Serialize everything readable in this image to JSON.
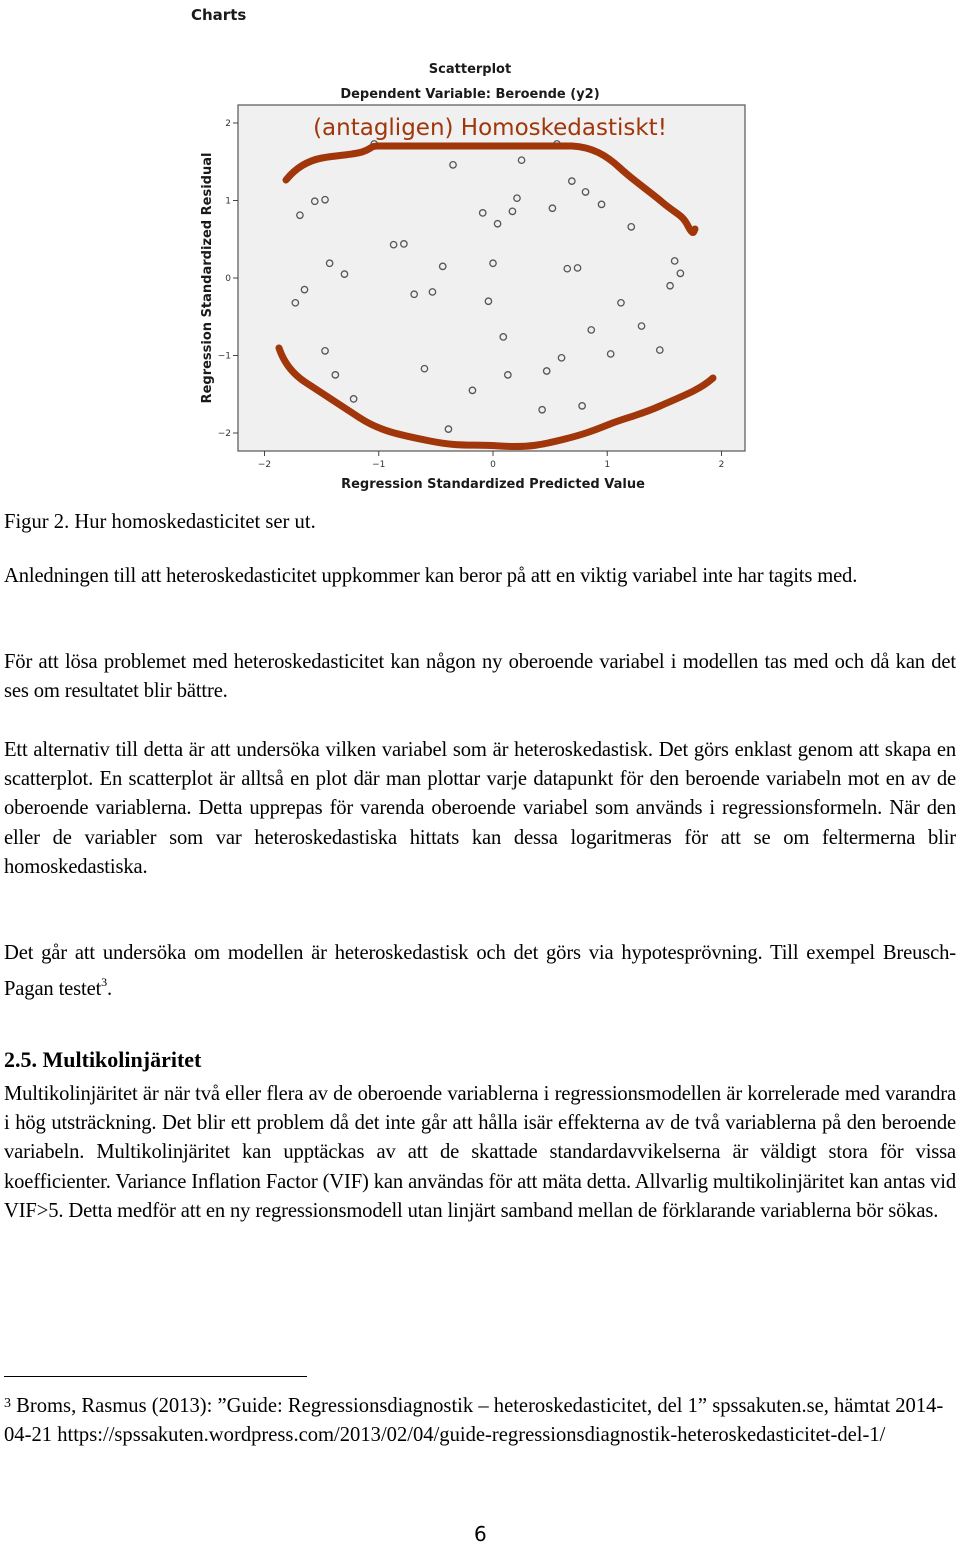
{
  "charts_heading": "Charts",
  "chart_data": {
    "type": "scatter",
    "title": "Scatterplot",
    "subtitle": "Dependent Variable: Beroende (y2)",
    "xlabel": "Regression Standardized Predicted Value",
    "ylabel": "Regression Standardized Residual",
    "xlim": [
      -2.2,
      2.2
    ],
    "ylim": [
      -2.2,
      2.2
    ],
    "xticks": [
      -2,
      -1,
      0,
      1,
      2
    ],
    "yticks": [
      -2,
      -1,
      0,
      1,
      2
    ],
    "grid": false,
    "annotation": "(antagligen) Homoskedastiskt!",
    "annotation_color": "#a0360a",
    "marker": "open-circle",
    "points": [
      [
        -1.69,
        0.81
      ],
      [
        -1.56,
        0.99
      ],
      [
        -1.47,
        1.01
      ],
      [
        -1.04,
        1.73
      ],
      [
        -0.35,
        1.46
      ],
      [
        -0.87,
        0.43
      ],
      [
        -0.78,
        0.44
      ],
      [
        -1.43,
        0.19
      ],
      [
        -1.3,
        0.05
      ],
      [
        -0.44,
        0.15
      ],
      [
        -0.09,
        0.84
      ],
      [
        0.04,
        0.7
      ],
      [
        0.0,
        0.19
      ],
      [
        -1.65,
        -0.15
      ],
      [
        -1.73,
        -0.32
      ],
      [
        -0.69,
        -0.21
      ],
      [
        -0.53,
        -0.18
      ],
      [
        -0.04,
        -0.3
      ],
      [
        -1.47,
        -0.94
      ],
      [
        -1.38,
        -1.25
      ],
      [
        -0.6,
        -1.17
      ],
      [
        -0.18,
        -1.45
      ],
      [
        -1.22,
        -1.56
      ],
      [
        -0.39,
        -1.95
      ],
      [
        0.56,
        1.73
      ],
      [
        0.25,
        1.52
      ],
      [
        0.69,
        1.25
      ],
      [
        0.81,
        1.11
      ],
      [
        0.95,
        0.95
      ],
      [
        0.21,
        1.03
      ],
      [
        0.17,
        0.86
      ],
      [
        0.52,
        0.9
      ],
      [
        0.65,
        0.12
      ],
      [
        0.74,
        0.13
      ],
      [
        1.59,
        0.22
      ],
      [
        1.64,
        0.06
      ],
      [
        1.55,
        -0.1
      ],
      [
        1.21,
        0.66
      ],
      [
        1.12,
        -0.32
      ],
      [
        0.09,
        -0.76
      ],
      [
        0.86,
        -0.67
      ],
      [
        1.3,
        -0.62
      ],
      [
        0.6,
        -1.03
      ],
      [
        1.03,
        -0.98
      ],
      [
        1.46,
        -0.93
      ],
      [
        0.13,
        -1.25
      ],
      [
        0.47,
        -1.2
      ],
      [
        0.43,
        -1.7
      ],
      [
        0.78,
        -1.65
      ]
    ]
  },
  "caption": "Figur 2. Hur homoskedasticitet ser ut.",
  "paragraphs": {
    "p1": "Anledningen till att heteroskedasticitet uppkommer kan beror på att en viktig variabel inte har tagits med.",
    "p2": "För att lösa problemet med heteroskedasticitet kan någon ny oberoende variabel i modellen tas med och då kan det ses om resultatet blir bättre.",
    "p3": "Ett alternativ till detta är att undersöka vilken variabel som är heteroskedastisk. Det görs enklast genom att skapa en scatterplot. En scatterplot är alltså en plot där man plottar varje datapunkt för den beroende variabeln mot en av de oberoende variablerna. Detta upprepas för varenda oberoende variabel som används i regressionsformeln. När den eller de variabler som var heteroskedastiska hittats kan dessa logaritmeras för att se om feltermerna blir homoskedastiska.",
    "p4": "Det går att undersöka om modellen är heteroskedastisk och det görs via hypotesprövning. Till exempel Breusch-Pagan testet",
    "p4_footnote_ref": "3",
    "p4_end": ".",
    "p5": "Multikolinjäritet är när två eller flera av de oberoende variablerna i regressionsmodellen är korrelerade med varandra i hög utsträckning. Det blir ett problem då det inte går att hålla isär effekterna av de två variablerna på den beroende variabeln. Multikolinjäritet kan upptäckas av att de skattade standardavvikelserna är väldigt stora för vissa koefficienter. Variance Inflation Factor (VIF) kan användas för att mäta detta. Allvarlig multikolinjäritet kan antas vid VIF>5. Detta medför att en ny regressionsmodell utan linjärt samband mellan de förklarande variablerna bör sökas."
  },
  "section_heading": "2.5. Multikolinjäritet",
  "footnote": {
    "mark": "3",
    "text": " Broms, Rasmus (2013): ”Guide: Regressionsdiagnostik – heteroskedasticitet, del 1” spssakuten.se, hämtat 2014-04-21 https://spssakuten.wordpress.com/2013/02/04/guide-regressionsdiagnostik-heteroskedasticitet-del-1/"
  },
  "page_number": "6"
}
